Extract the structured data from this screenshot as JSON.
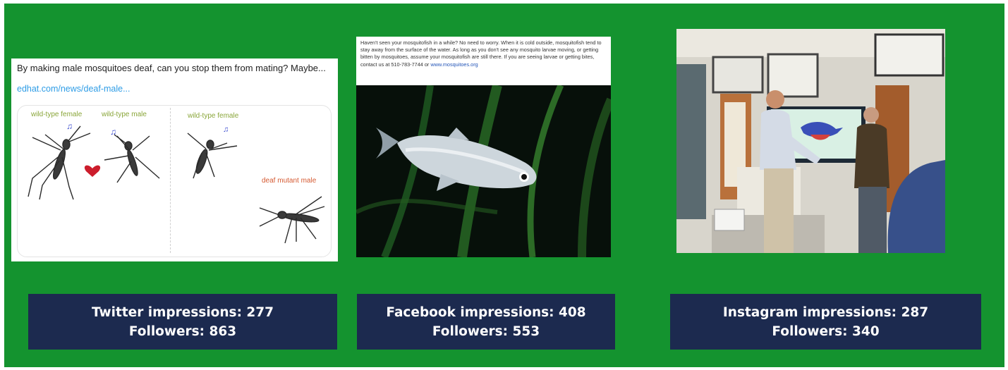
{
  "colors": {
    "background": "#14932f",
    "stat_box": "#1c2a4f",
    "stat_text": "#ffffff",
    "link": "#2f9de6"
  },
  "twitter": {
    "post_text": "By making male mosquitoes deaf, can you stop them from mating? Maybe...",
    "link": "edhat.com/news/deaf-male...",
    "labels": {
      "female_1": "wild-type female",
      "male_1": "wild-type male",
      "female_2": "wild-type female",
      "mutant": "deaf mutant male"
    },
    "stats": {
      "impressions": "Twitter impressions: 277",
      "followers": "Followers: 863"
    }
  },
  "facebook": {
    "post_text": "Haven't seen your mosquitofish in a while? No need to worry. When it is cold outside, mosquitofish tend to stay away from the surface of the water. As long as you don't see any mosquito larvae moving, or getting bitten by mosquitoes, assume your mosquitofish are still there. If you are seeing larvae or getting bites, contact us at 510-783-7744 or",
    "link": "www.mosquitoes.org",
    "stats": {
      "impressions": "Facebook impressions: 408",
      "followers": "Followers: 553"
    }
  },
  "instagram": {
    "stats": {
      "impressions": "Instagram impressions: 287",
      "followers": "Followers: 340"
    }
  }
}
